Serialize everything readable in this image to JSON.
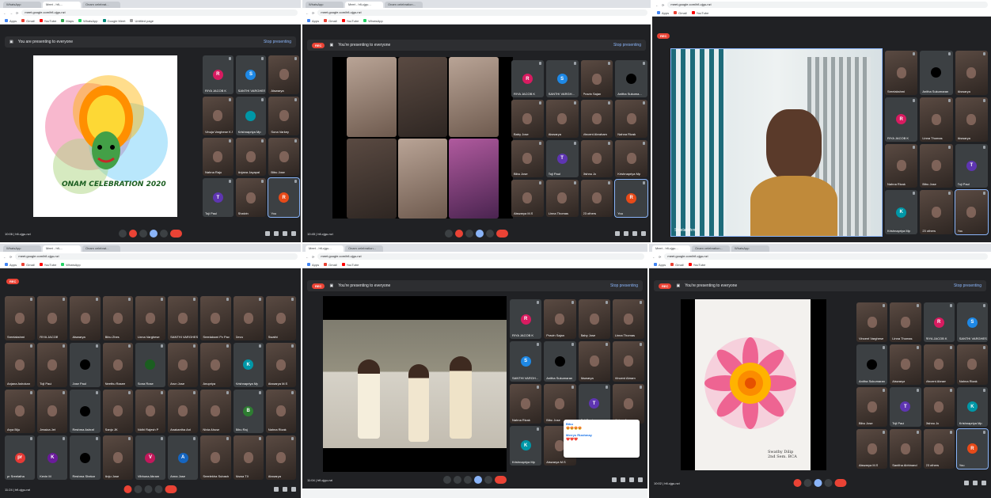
{
  "collage_label": "Onam celebration 2020 online meeting screenshots",
  "panels": {
    "p1": {
      "tabs": [
        "WhatsApp",
        "Meet - hfi-...",
        "Onam celebrat..."
      ],
      "url": "meet.google.com/hfi-cjgu-nzi",
      "bookmarks": [
        "Apps",
        "Gmail",
        "YouTube",
        "Maps",
        "WhatsApp",
        "Google Meet",
        "Untitled page"
      ],
      "present_text": "You are presenting to everyone",
      "stop_text": "Stop presenting",
      "slide_caption": "ONAM CELEBRATION 2020",
      "meeting": "hfi-cjgu-nzi",
      "time": "10:06",
      "tiles": [
        {
          "name": "RIYA JACOB K",
          "initial": "R",
          "color": "#d81b60"
        },
        {
          "name": "SANTHI VARGHESE",
          "initial": "S",
          "color": "#1e88e5"
        },
        {
          "name": "Aiswarya",
          "initial": "",
          "color": ""
        },
        {
          "name": "Vinuja Varghese K.S",
          "initial": "",
          "color": ""
        },
        {
          "name": "Krishnapriya Mp",
          "initial": "",
          "color": "#0097a7"
        },
        {
          "name": "Sona Varkey",
          "initial": "",
          "color": ""
        },
        {
          "name": "Nahna Raju",
          "initial": "",
          "color": ""
        },
        {
          "name": "Anjana Jayapal",
          "initial": "",
          "color": ""
        },
        {
          "name": "Bibu Jose",
          "initial": "",
          "color": ""
        },
        {
          "name": "Toji Paul",
          "initial": "T",
          "color": "#5e35b1"
        },
        {
          "name": "Shalvin",
          "initial": "",
          "color": ""
        },
        {
          "name": "You",
          "initial": "R",
          "color": "#e64a19"
        }
      ]
    },
    "p2": {
      "tabs": [
        "WhatsApp",
        "Meet - hfi-cjgu...",
        "Onam celebration..."
      ],
      "url": "meet.google.com/hfi-cjgu-nzi",
      "present_text": "You're presenting to everyone",
      "stop_text": "Stop presenting",
      "time": "10:45",
      "meeting": "hfi-cjgu-nzi",
      "tiles": [
        {
          "name": "RIYA JACOB K",
          "initial": "R",
          "color": "#d81b60"
        },
        {
          "name": "SANTHI VARGH...",
          "initial": "S",
          "color": "#1e88e5"
        },
        {
          "name": "Pravin Sajan",
          "initial": "",
          "color": ""
        },
        {
          "name": "Anitha Sukuma...",
          "initial": "",
          "color": "#000000"
        },
        {
          "name": "Baby Jose",
          "initial": "",
          "color": ""
        },
        {
          "name": "Aiswarya",
          "initial": "",
          "color": ""
        },
        {
          "name": "Vincent Abraham",
          "initial": "",
          "color": ""
        },
        {
          "name": "Nahna Rizak",
          "initial": "",
          "color": ""
        },
        {
          "name": "Bibu Jose",
          "initial": "",
          "color": ""
        },
        {
          "name": "Toji Paul",
          "initial": "T",
          "color": "#5e35b1"
        },
        {
          "name": "Jishnu Jo",
          "initial": "",
          "color": ""
        },
        {
          "name": "Krishnapriya Mp",
          "initial": "",
          "color": ""
        },
        {
          "name": "Aiswarya M.S",
          "initial": "",
          "color": ""
        },
        {
          "name": "Linna Thomas",
          "initial": "",
          "color": ""
        },
        {
          "name": "23 others",
          "initial": "",
          "color": ""
        },
        {
          "name": "You",
          "initial": "R",
          "color": "#e64a19"
        }
      ]
    },
    "p3": {
      "url": "meet.google.com/hfi-cjgu-nzi",
      "speaker_label": "Sreelakshmi",
      "tiles": [
        {
          "name": "Sreelakshmi",
          "initial": "",
          "color": ""
        },
        {
          "name": "Anitha Sukumaran",
          "initial": "",
          "color": "#000000"
        },
        {
          "name": "Aiswarya",
          "initial": "",
          "color": ""
        },
        {
          "name": "RIYA JACOB K",
          "initial": "R",
          "color": "#d81b60"
        },
        {
          "name": "Linna Thomas",
          "initial": "",
          "color": ""
        },
        {
          "name": "Aiswarya",
          "initial": "",
          "color": ""
        },
        {
          "name": "Nahna Rizak",
          "initial": "",
          "color": ""
        },
        {
          "name": "Bibu Jose",
          "initial": "",
          "color": ""
        },
        {
          "name": "Toji Paul",
          "initial": "T",
          "color": "#5e35b1"
        },
        {
          "name": "Krishnapriya Mp",
          "initial": "K",
          "color": "#0097a7"
        },
        {
          "name": "23 others",
          "initial": "",
          "color": ""
        },
        {
          "name": "You",
          "initial": "",
          "color": ""
        }
      ]
    },
    "p4": {
      "url": "meet.google.com/hfi-cjgu-nzi",
      "meeting": "hfi-cjgu-nzi",
      "time": "11:24",
      "tiles": [
        {
          "name": "Sreelakshmi",
          "initial": "",
          "color": ""
        },
        {
          "name": "RIYA JACOB",
          "initial": "",
          "color": ""
        },
        {
          "name": "Aiswarya",
          "initial": "",
          "color": ""
        },
        {
          "name": "Bibu Zhes",
          "initial": "",
          "color": ""
        },
        {
          "name": "Linna Varghese",
          "initial": "",
          "color": ""
        },
        {
          "name": "SANTHI VARGHESE",
          "initial": "",
          "color": ""
        },
        {
          "name": "Sreelaksmi Pv Pav",
          "initial": "",
          "color": ""
        },
        {
          "name": "Devu",
          "initial": "",
          "color": ""
        },
        {
          "name": "Swathi",
          "initial": "",
          "color": ""
        },
        {
          "name": "Anjana Ashokan",
          "initial": "",
          "color": ""
        },
        {
          "name": "Toji Paul",
          "initial": "",
          "color": ""
        },
        {
          "name": "Jose Paul",
          "initial": "",
          "color": "#000000"
        },
        {
          "name": "Neethu Rasee",
          "initial": "",
          "color": ""
        },
        {
          "name": "Sona Rose",
          "initial": "",
          "color": "#1b5e20"
        },
        {
          "name": "Arun Jose",
          "initial": "",
          "color": ""
        },
        {
          "name": "Anupriya",
          "initial": "",
          "color": ""
        },
        {
          "name": "Krishnapriya Mp",
          "initial": "K",
          "color": "#0097a7"
        },
        {
          "name": "Aiswarya M.S",
          "initial": "",
          "color": ""
        },
        {
          "name": "Arya Biju",
          "initial": "",
          "color": ""
        },
        {
          "name": "Jessica Jet",
          "initial": "",
          "color": ""
        },
        {
          "name": "Reshma Ashraf",
          "initial": "",
          "color": "#000000"
        },
        {
          "name": "Sanjo JK",
          "initial": "",
          "color": ""
        },
        {
          "name": "Nidhi Rajesh P",
          "initial": "",
          "color": ""
        },
        {
          "name": "Anakantha Ani",
          "initial": "",
          "color": ""
        },
        {
          "name": "Nivia Ahuse",
          "initial": "",
          "color": ""
        },
        {
          "name": "Bibu Raj",
          "initial": "B",
          "color": "#2e7d32"
        },
        {
          "name": "Nahna Rizak",
          "initial": "",
          "color": ""
        },
        {
          "name": "pr Sreelatha",
          "initial": "pr",
          "color": "#e53935"
        },
        {
          "name": "Kevin M",
          "initial": "K",
          "color": "#6a1b9a"
        },
        {
          "name": "Reshma Shekar",
          "initial": "",
          "color": "#000000"
        },
        {
          "name": "Anju Jose",
          "initial": "",
          "color": ""
        },
        {
          "name": "Vibhuna Abram",
          "initial": "V",
          "color": "#c2185b"
        },
        {
          "name": "Anna Jose",
          "initial": "A",
          "color": "#1565c0"
        },
        {
          "name": "Sreelekha Subash",
          "initial": "",
          "color": ""
        },
        {
          "name": "Aiswa TX",
          "initial": "",
          "color": ""
        },
        {
          "name": "Aiswarya",
          "initial": "",
          "color": ""
        }
      ]
    },
    "p5": {
      "url": "meet.google.com/hfi-cjgu-nzi",
      "present_text": "You're presenting to everyone",
      "stop_text": "Stop presenting",
      "time": "11:04",
      "meeting": "hfi-cjgu-nzi",
      "chat_1_name": "Bibu",
      "chat_1_msg": "😍😍😍😍",
      "chat_2_name": "Merrys Rizahmay",
      "chat_2_msg": "❤️❤️❤️",
      "tiles": [
        {
          "name": "RIYA JACOB K",
          "initial": "R",
          "color": "#d81b60"
        },
        {
          "name": "Pravin Sajan",
          "initial": "",
          "color": ""
        },
        {
          "name": "Baby Jose",
          "initial": "",
          "color": ""
        },
        {
          "name": "Linna Thomas",
          "initial": "",
          "color": ""
        },
        {
          "name": "SANTHI VARGH...",
          "initial": "S",
          "color": "#1e88e5"
        },
        {
          "name": "Anitha Sukumaran",
          "initial": "",
          "color": "#000000"
        },
        {
          "name": "Aiswarya",
          "initial": "",
          "color": ""
        },
        {
          "name": "Vincent Abram",
          "initial": "",
          "color": ""
        },
        {
          "name": "Nahna Rizak",
          "initial": "",
          "color": ""
        },
        {
          "name": "Bibu Jose",
          "initial": "",
          "color": ""
        },
        {
          "name": "Toji Paul",
          "initial": "T",
          "color": "#5e35b1"
        },
        {
          "name": "Jishnu Jo",
          "initial": "",
          "color": ""
        },
        {
          "name": "Krishnapriya Mp",
          "initial": "K",
          "color": "#0097a7"
        },
        {
          "name": "Aiswarya M.S",
          "initial": "",
          "color": ""
        }
      ]
    },
    "p6": {
      "url": "meet.google.com/hfi-cjgu-nzi",
      "present_text": "You're presenting to everyone",
      "stop_text": "Stop presenting",
      "time": "10:02",
      "meeting": "hfi-cjgu-nzi",
      "drawing_caption": "Swathy Dilip\n2nd Sem. BCA",
      "tiles": [
        {
          "name": "Vincent Varghese",
          "initial": "",
          "color": ""
        },
        {
          "name": "Linna Thomas",
          "initial": "",
          "color": ""
        },
        {
          "name": "RIYA JACOB K",
          "initial": "R",
          "color": "#d81b60"
        },
        {
          "name": "SANTHI VARGHESE",
          "initial": "S",
          "color": "#1e88e5"
        },
        {
          "name": "Anitha Sukumaran",
          "initial": "",
          "color": "#000000"
        },
        {
          "name": "Aiswarya",
          "initial": "",
          "color": ""
        },
        {
          "name": "Vincent Abram",
          "initial": "",
          "color": ""
        },
        {
          "name": "Nahna Rizak",
          "initial": "",
          "color": ""
        },
        {
          "name": "Bibu Jose",
          "initial": "",
          "color": ""
        },
        {
          "name": "Toji Paul",
          "initial": "T",
          "color": "#5e35b1"
        },
        {
          "name": "Jishnu Jo",
          "initial": "",
          "color": ""
        },
        {
          "name": "Krishnapriya Mp",
          "initial": "K",
          "color": "#0097a7"
        },
        {
          "name": "Aiswarya M.S",
          "initial": "",
          "color": ""
        },
        {
          "name": "Sanitha Abhinand",
          "initial": "",
          "color": ""
        },
        {
          "name": "23 others",
          "initial": "",
          "color": ""
        },
        {
          "name": "You",
          "initial": "R",
          "color": "#e64a19"
        }
      ]
    }
  }
}
